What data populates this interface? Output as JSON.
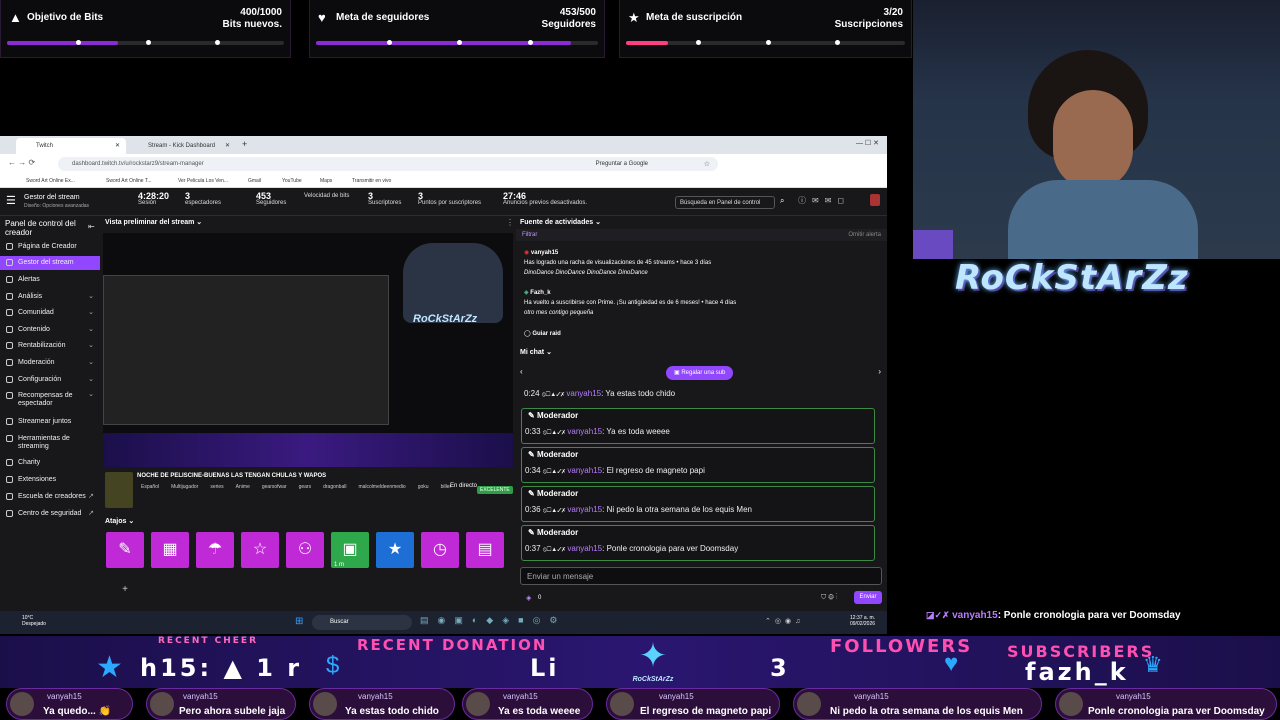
{
  "goals": [
    {
      "label": "Objetivo de Bits",
      "count": "400/1000",
      "unit": "Bits nuevos.",
      "icon": "triangle-icon",
      "progress": 0.4
    },
    {
      "label": "Meta de seguidores",
      "count": "453/500",
      "unit": "Seguidores",
      "icon": "heart-icon",
      "progress": 0.906
    },
    {
      "label": "Meta de suscripción",
      "count": "3/20",
      "unit": "Suscripciones",
      "icon": "star-icon",
      "progress": 0.15
    }
  ],
  "browser": {
    "tab1": "Twitch",
    "tab2": "Stream - Kick Dashboard",
    "url": "dashboard.twitch.tv/u/rockstarz9/stream-manager",
    "ask_google": "Preguntar a Google",
    "bookmarks": [
      "Sword Art Online Ex...",
      "Sword Art Online T...",
      "Ver Pelicula Los Ven...",
      "Gmail",
      "YouTube",
      "Maps",
      "Transmitir en vivo"
    ]
  },
  "twitch": {
    "manager_title": "Gestor del stream",
    "manager_sub": "Diseño: Opciones avanzadas",
    "stats": [
      {
        "value": "4:28:20",
        "label": "Sesión"
      },
      {
        "value": "3",
        "label": "espectadores"
      },
      {
        "value": "453",
        "label": "Seguidores"
      },
      {
        "value": "",
        "label": "Velocidad de bits"
      },
      {
        "value": "3",
        "label": "Suscriptores"
      },
      {
        "value": "3",
        "label": "Puntos por suscriptores"
      },
      {
        "value": "27:46",
        "label": "Anuncios previos desactivados."
      }
    ],
    "search_placeholder": "Búsqueda en Panel de control",
    "sidebar_title": "Panel de control del creador",
    "sidebar": [
      "Página de Creador",
      "Gestor del stream",
      "Alertas",
      "Análisis",
      "Comunidad",
      "Contenido",
      "Rentabilización",
      "Moderación",
      "Configuración",
      "Recompensas de espectador",
      "Streamear juntos",
      "Herramientas de streaming",
      "Charity",
      "Extensiones",
      "Escuela de creadores",
      "Centro de seguridad"
    ],
    "preview_title": "Vista preliminar del stream",
    "stream_title": "NOCHE DE PELISCINE-BUENAS LAS TENGAN CHULAS Y WAPOS",
    "tags": [
      "Español",
      "Multijugador",
      "series",
      "Anime",
      "gearsofwar",
      "gears",
      "dragonball",
      "malcolmeldeenmedio",
      "goku",
      "biller"
    ],
    "live_label": "En directo",
    "quality": "EXCELENTE",
    "shortcuts_title": "Atajos",
    "shortcut_badge": "1 m",
    "add_label": "+",
    "feed_title": "Fuente de actividades",
    "filter": "Filtrar",
    "skip_alert": "Omitir alerta",
    "feed": [
      {
        "user": "vanyah15",
        "text": "Has logrado una racha de visualizaciones de 45 streams • hace 3 días",
        "sub": "DinoDance DinoDance DinoDance DinoDance"
      },
      {
        "user": "Fazh_k",
        "text": "Ha vuelto a suscribirse con Prime. ¡Su antigüedad es de 6 meses! • hace 4 días",
        "sub": "otro mes contigo pequeña"
      },
      {
        "user": "Guiar raid",
        "text": "",
        "sub": ""
      }
    ],
    "chat_title": "Mi chat",
    "gift_button": "Regalar una sub",
    "mod_label": "Moderador",
    "messages": [
      {
        "time": "0:24",
        "user": "vanyah15",
        "text": "Ya estas todo chido"
      },
      {
        "time": "0:33",
        "user": "vanyah15",
        "text": "Ya es toda weeee"
      },
      {
        "time": "0:34",
        "user": "vanyah15",
        "text": "El regreso de magneto papi"
      },
      {
        "time": "0:36",
        "user": "vanyah15",
        "text": "Ni pedo la otra semana de los equis Men"
      },
      {
        "time": "0:37",
        "user": "vanyah15",
        "text": "Ponle cronologia para ver Doomsday"
      }
    ],
    "chat_placeholder": "Enviar un mensaje",
    "points": "0",
    "send": "Enviar"
  },
  "taskbar": {
    "weather_temp": "10°C",
    "weather": "Despejado",
    "search": "Buscar",
    "time": "12:37 a. m.",
    "date": "09/02/2026"
  },
  "overlay": {
    "logo": "RoCkStArZz",
    "latest_chat_user": "vanyah15",
    "latest_chat_text": ": Ponle cronologia para ver Doomsday",
    "recent_cheer_label": "RECENT CHEER",
    "recent_cheer_value": "h15: ▲ 1 r",
    "recent_donation_label": "RECENT DONATION",
    "recent_donation_value": "Li",
    "followers_label": "FOLLOWERS",
    "followers_value": "3",
    "subscribers_label": "SUBSCRIBERS",
    "subscribers_value": "fazh_k",
    "ticker": [
      {
        "user": "vanyah15",
        "text": "Ya quedo... 👏"
      },
      {
        "user": "vanyah15",
        "text": "Pero ahora subele jaja"
      },
      {
        "user": "vanyah15",
        "text": "Ya estas todo chido"
      },
      {
        "user": "vanyah15",
        "text": "Ya es toda weeee"
      },
      {
        "user": "vanyah15",
        "text": "El regreso de magneto papi"
      },
      {
        "user": "vanyah15",
        "text": "Ni pedo la otra semana de los equis Men"
      },
      {
        "user": "vanyah15",
        "text": "Ponle cronologia para ver Doomsday"
      }
    ]
  },
  "colors": {
    "accent": "#9147ff",
    "mod_border": "#3d8a46",
    "goal_fill": "#8b2bd6",
    "ribbon_pink": "#ff4fb0"
  }
}
